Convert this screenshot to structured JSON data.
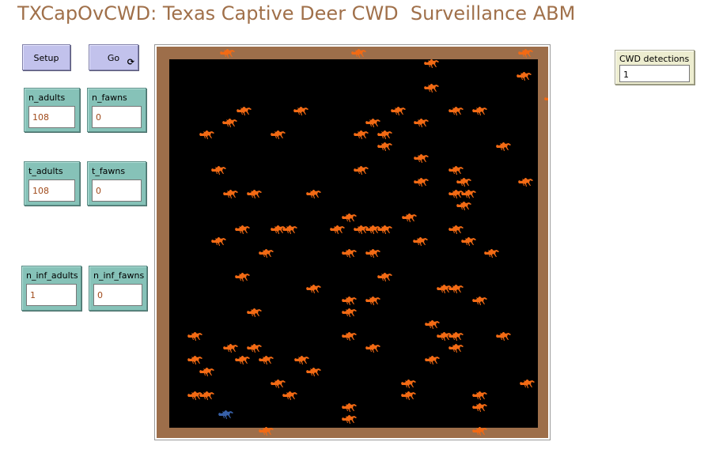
{
  "title": "TXCapOvCWD: Texas Captive Deer CWD  Surveillance ABM",
  "buttons": {
    "setup": {
      "label": "Setup"
    },
    "go": {
      "label": "Go",
      "forever_icon": "forever-arrows-icon"
    }
  },
  "monitors": {
    "n_adults": {
      "label": "n_adults",
      "value": "108"
    },
    "n_fawns": {
      "label": "n_fawns",
      "value": "0"
    },
    "t_adults": {
      "label": "t_adults",
      "value": "108"
    },
    "t_fawns": {
      "label": "t_fawns",
      "value": "0"
    },
    "n_inf_adults": {
      "label": "n_inf_adults",
      "value": "1"
    },
    "n_inf_fawns": {
      "label": "n_inf_fawns",
      "value": "0"
    },
    "cwd_detections": {
      "label": "CWD detections",
      "value": "1"
    }
  },
  "world": {
    "colors": {
      "pen": "#000000",
      "fence": "#9d6e4a",
      "deer": "#f26a14",
      "detected_deer": "#3760a8"
    },
    "deer_icon": "deer-icon",
    "deer_count": 108,
    "detected_deer_count": 1
  }
}
